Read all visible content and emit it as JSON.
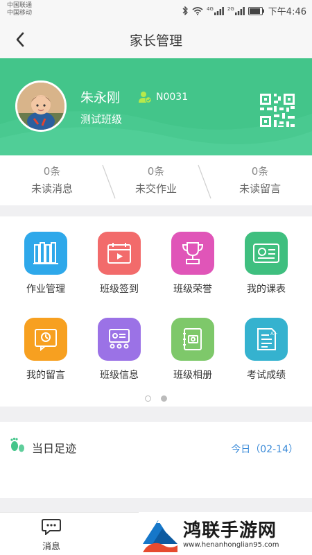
{
  "status_bar": {
    "carrier_1": "中国联通",
    "carrier_2": "中国移动",
    "sig1_label": "4G",
    "sig2_label": "2G",
    "time": "下午4:46"
  },
  "header": {
    "title": "家长管理",
    "back_icon": "chevron-left-icon"
  },
  "profile": {
    "name": "朱永刚",
    "student_id": "N0031",
    "class_name": "测试班级",
    "accent_color": "#43c58a"
  },
  "stats": [
    {
      "count": "0条",
      "label": "未读消息"
    },
    {
      "count": "0条",
      "label": "未交作业"
    },
    {
      "count": "0条",
      "label": "未读留言"
    }
  ],
  "grid": [
    {
      "label": "作业管理",
      "icon": "books-icon",
      "color": "#2ea8ea"
    },
    {
      "label": "班级签到",
      "icon": "calendar-icon",
      "color": "#f26b6b"
    },
    {
      "label": "班级荣誉",
      "icon": "trophy-icon",
      "color": "#e055b8"
    },
    {
      "label": "我的课表",
      "icon": "schedule-card-icon",
      "color": "#3fbf7f"
    },
    {
      "label": "我的留言",
      "icon": "message-board-icon",
      "color": "#f7a020"
    },
    {
      "label": "班级信息",
      "icon": "classroom-board-icon",
      "color": "#9b72e6"
    },
    {
      "label": "班级相册",
      "icon": "photo-album-icon",
      "color": "#7ec86a"
    },
    {
      "label": "考试成绩",
      "icon": "exam-sheet-icon",
      "color": "#35b2cf"
    }
  ],
  "pager": {
    "active_index": 1,
    "total": 2
  },
  "footprint": {
    "title": "当日足迹",
    "date": "今日（02-14）"
  },
  "tabbar": {
    "messages_label": "消息"
  },
  "watermark": {
    "title": "鸿联手游网",
    "url": "www.henanhonglian95.com"
  }
}
